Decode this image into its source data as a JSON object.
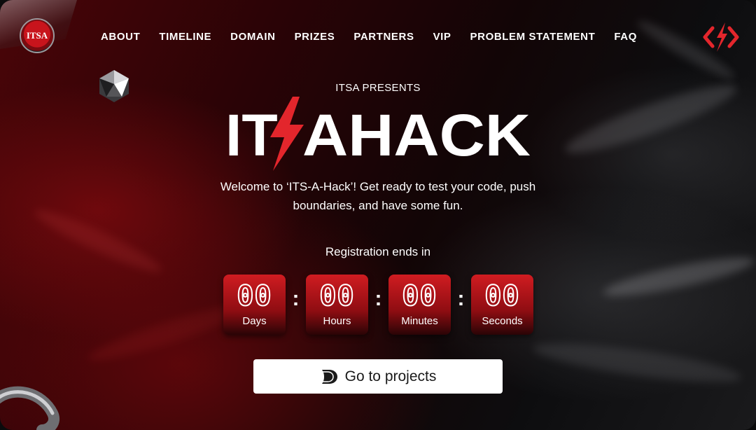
{
  "logo": {
    "text": "ITSA"
  },
  "nav": {
    "items": [
      {
        "label": "ABOUT"
      },
      {
        "label": "TIMELINE"
      },
      {
        "label": "DOMAIN"
      },
      {
        "label": "PRIZES"
      },
      {
        "label": "PARTNERS"
      },
      {
        "label": "VIP"
      },
      {
        "label": "PROBLEM STATEMENT"
      },
      {
        "label": "FAQ"
      }
    ]
  },
  "hero": {
    "presents": "ITSA PRESENTS",
    "brand_left": "IT",
    "brand_right": "AHACK",
    "tagline": "Welcome to ‘ITS-A-Hack’! Get ready to test your code, push boundaries, and have some fun."
  },
  "countdown": {
    "heading": "Registration ends in",
    "units": [
      {
        "value": "00",
        "label": "Days"
      },
      {
        "value": "00",
        "label": "Hours"
      },
      {
        "value": "00",
        "label": "Minutes"
      },
      {
        "value": "00",
        "label": "Seconds"
      }
    ],
    "separator": ":"
  },
  "cta": {
    "label": "Go to projects",
    "icon": "devfolio-icon"
  },
  "colors": {
    "accent": "#e3262c",
    "button_bg": "#ffffff"
  }
}
